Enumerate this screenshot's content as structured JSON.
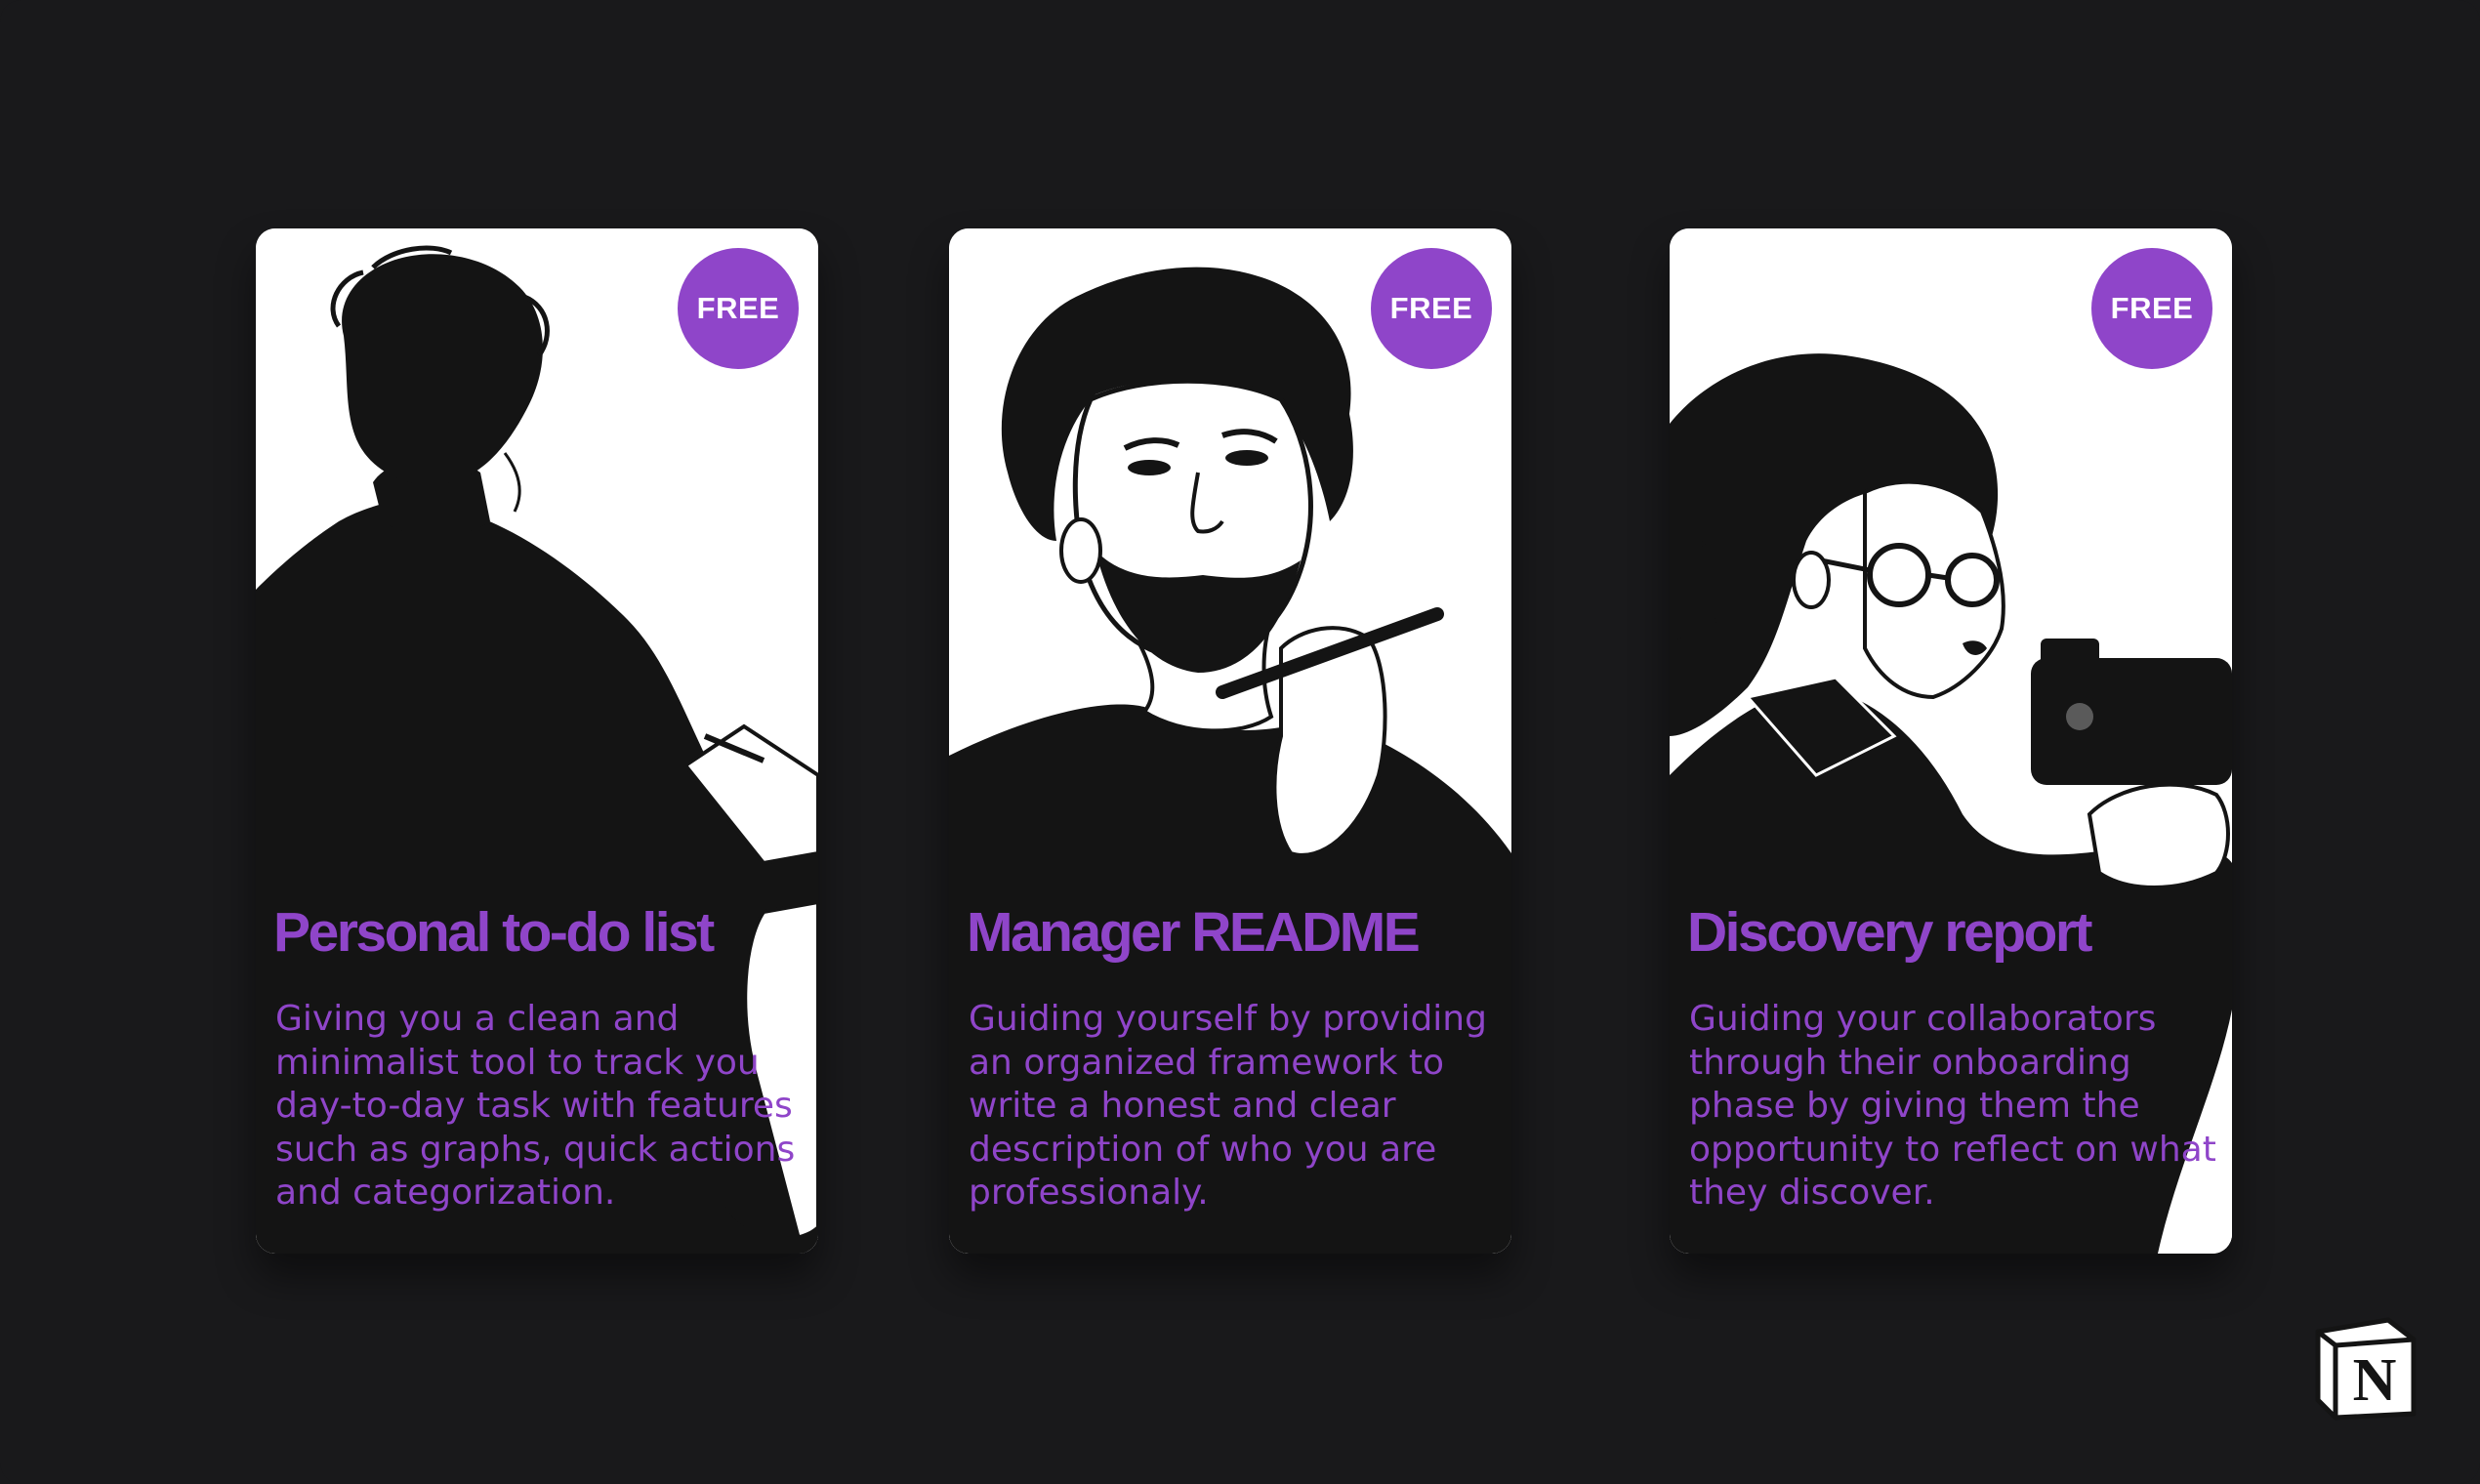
{
  "cards": [
    {
      "badge": "FREE",
      "title": "Personal to-do list",
      "description": "Giving you a clean and minimalist tool to track you day-to-day task with features such as graphs, quick actions and categorization."
    },
    {
      "badge": "FREE",
      "title": "Manager README",
      "description": "Guiding yourself by providing an organized framework to write a honest and clear description of who you are professionaly."
    },
    {
      "badge": "FREE",
      "title": "Discovery report",
      "description": "Guiding your collaborators through their onboarding phase by giving them the opportunity to reflect on what they discover."
    }
  ],
  "logo": {
    "letter": "N",
    "icon": "notion-logo-icon"
  },
  "colors": {
    "background": "#19191b",
    "accent": "#8f45c9",
    "card": "#ffffff",
    "ink": "#141414"
  }
}
